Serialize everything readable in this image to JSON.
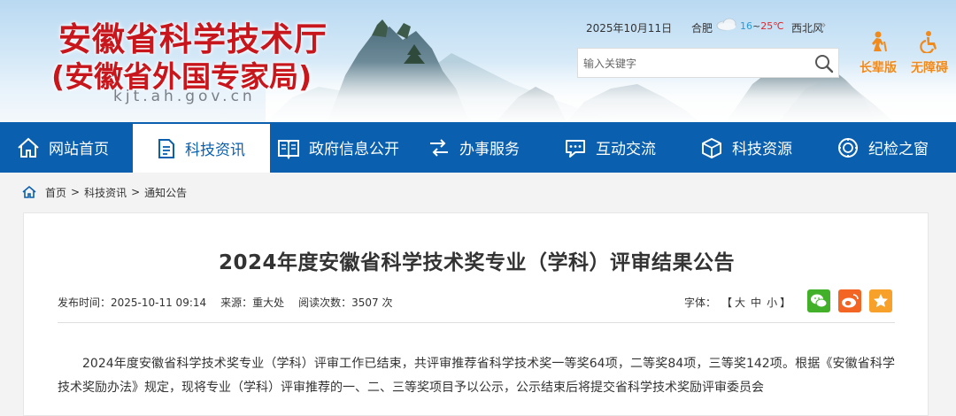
{
  "header": {
    "site_title": "安徽省科学技术厅",
    "site_subtitle": "(安徽省外国专家局)",
    "domain": "kjt.ah.gov.cn",
    "date": "2025年10月11日",
    "city": "合肥",
    "temp_low": "16",
    "temp_sep": "~",
    "temp_high": "25℃",
    "wind": "西北风",
    "wind_more": "»",
    "weather_icon": "cloudy-icon",
    "search_placeholder": "输入关键字",
    "elder_label": "长辈版",
    "access_label": "无障碍"
  },
  "nav": {
    "items": [
      {
        "label": "网站首页",
        "icon": "home-icon"
      },
      {
        "label": "科技资讯",
        "icon": "document-icon"
      },
      {
        "label": "政府信息公开",
        "icon": "book-icon"
      },
      {
        "label": "办事服务",
        "icon": "service-icon"
      },
      {
        "label": "互动交流",
        "icon": "chat-icon"
      },
      {
        "label": "科技资源",
        "icon": "cube-icon"
      },
      {
        "label": "纪检之窗",
        "icon": "badge-icon"
      }
    ],
    "active_index": 1
  },
  "breadcrumb": {
    "items": [
      "首页",
      "科技资讯",
      "通知公告"
    ],
    "separator": ">"
  },
  "article": {
    "title": "2024年度安徽省科学技术奖专业（学科）评审结果公告",
    "published": "发布时间：2025-10-11 09:14",
    "source": "来源：重大处",
    "views": "阅读次数：3507 次",
    "font_label": "字体：",
    "font_open": "【",
    "font_large": "大",
    "font_medium": "中",
    "font_small": "小",
    "font_close": "】",
    "body": "2024年度安徽省科学技术奖专业（学科）评审工作已结束，共评审推荐省科学技术奖一等奖64项，二等奖84项，三等奖142项。根据《安徽省科学技术奖励办法》规定，现将专业（学科）评审推荐的一、二、三等奖项目予以公示，公示结束后将提交省科学技术奖励评审委员会"
  },
  "colors": {
    "brand_red": "#c8161d",
    "nav_blue": "#0a5fae",
    "accent_orange": "#f08a1c",
    "wechat_green": "#43b02a",
    "weibo_orange": "#f26522"
  }
}
